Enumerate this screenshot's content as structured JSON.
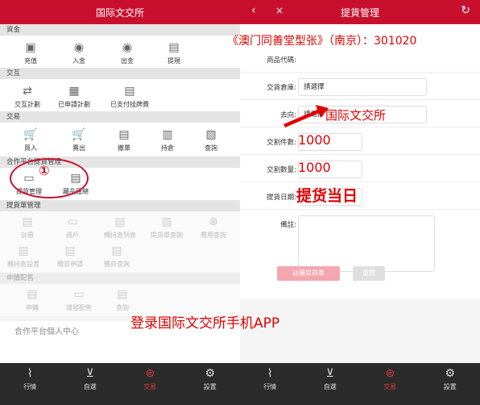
{
  "left": {
    "title": "国际文交所",
    "sections": {
      "funds": "資金",
      "interact": "交互",
      "trade": "交易",
      "coop": "合作平台提貨管理",
      "pickup": "提貨單管理",
      "apply": "申購配售"
    },
    "funds_items": [
      {
        "label": "充值",
        "icon": "safe-icon"
      },
      {
        "label": "入金",
        "icon": "deposit-icon"
      },
      {
        "label": "出金",
        "icon": "withdraw-icon"
      },
      {
        "label": "提現",
        "icon": "wallet-icon"
      }
    ],
    "interact_items": [
      {
        "label": "交互計劃",
        "icon": "transfer-icon"
      },
      {
        "label": "已申請計劃",
        "icon": "plan-icon"
      },
      {
        "label": "已支付挂牌費",
        "icon": "doc-icon"
      }
    ],
    "trade_items": [
      {
        "label": "買入",
        "icon": "cart-in-icon"
      },
      {
        "label": "賣出",
        "icon": "cart-out-icon"
      },
      {
        "label": "撤單",
        "icon": "cancel-doc-icon"
      },
      {
        "label": "持倉",
        "icon": "position-icon"
      },
      {
        "label": "查詢",
        "icon": "query-icon"
      }
    ],
    "coop_items": [
      {
        "label": "提貨管理",
        "icon": "pickup-icon"
      },
      {
        "label": "藏品匯總",
        "icon": "summary-icon"
      }
    ],
    "pickup_items_row1": [
      {
        "label": "註冊",
        "icon": "register-icon"
      },
      {
        "label": "過戶",
        "icon": "transfer-own-icon"
      },
      {
        "label": "轉持倉列表",
        "icon": "list-icon"
      },
      {
        "label": "提貨單查詢",
        "icon": "query-icon"
      },
      {
        "label": "費用查詢",
        "icon": "fee-icon"
      }
    ],
    "pickup_items_row2": [
      {
        "label": "轉持倉設置",
        "icon": "settings-icon"
      },
      {
        "label": "贖貨申請",
        "icon": "apply-icon"
      },
      {
        "label": "贖貨查詢",
        "icon": "query-icon"
      }
    ],
    "apply_items": [
      {
        "label": "申購",
        "icon": "apply-icon"
      },
      {
        "label": "增發配售",
        "icon": "add-icon"
      },
      {
        "label": "查詢",
        "icon": "query-icon"
      }
    ],
    "personal_center": "合作平台個人中心",
    "circle_num": "①"
  },
  "right": {
    "title": "提貨管理",
    "back": "‹",
    "close": "×",
    "refresh": "↻",
    "fields": [
      {
        "label": "商品代碼:",
        "value": ""
      },
      {
        "label": "交貨倉庫:",
        "value": "請選擇"
      },
      {
        "label": "去向:",
        "value": "請選擇"
      },
      {
        "label": "交割件數:",
        "value": ""
      },
      {
        "label": "交割數量:",
        "value": ""
      },
      {
        "label": "提貨日期:",
        "value": ""
      },
      {
        "label": "備註:",
        "value": ""
      }
    ],
    "btn_submit": "註冊提貨單",
    "btn_reset": "重置"
  },
  "tabs_left": [
    {
      "label": "行情",
      "icon": "chart-icon"
    },
    {
      "label": "自選",
      "icon": "cart-icon"
    },
    {
      "label": "交易",
      "icon": "trade-icon",
      "active": true
    },
    {
      "label": "設置",
      "icon": "gear-icon"
    }
  ],
  "tabs_right": [
    {
      "label": "行情",
      "icon": "chart-icon"
    },
    {
      "label": "自選",
      "icon": "cart-icon"
    },
    {
      "label": "交易",
      "icon": "trade-icon",
      "active": true
    },
    {
      "label": "設置",
      "icon": "gear-icon"
    }
  ],
  "overlays": {
    "product": "《澳门同善堂型张》（南京）：301020",
    "dest": "国际文交所",
    "qty1": "1000",
    "qty2": "1000",
    "date": "提货当日",
    "login": "登录国际文交所手机APP"
  },
  "colors": {
    "brand": "#c8102e",
    "overlay_red": "#e00000"
  }
}
